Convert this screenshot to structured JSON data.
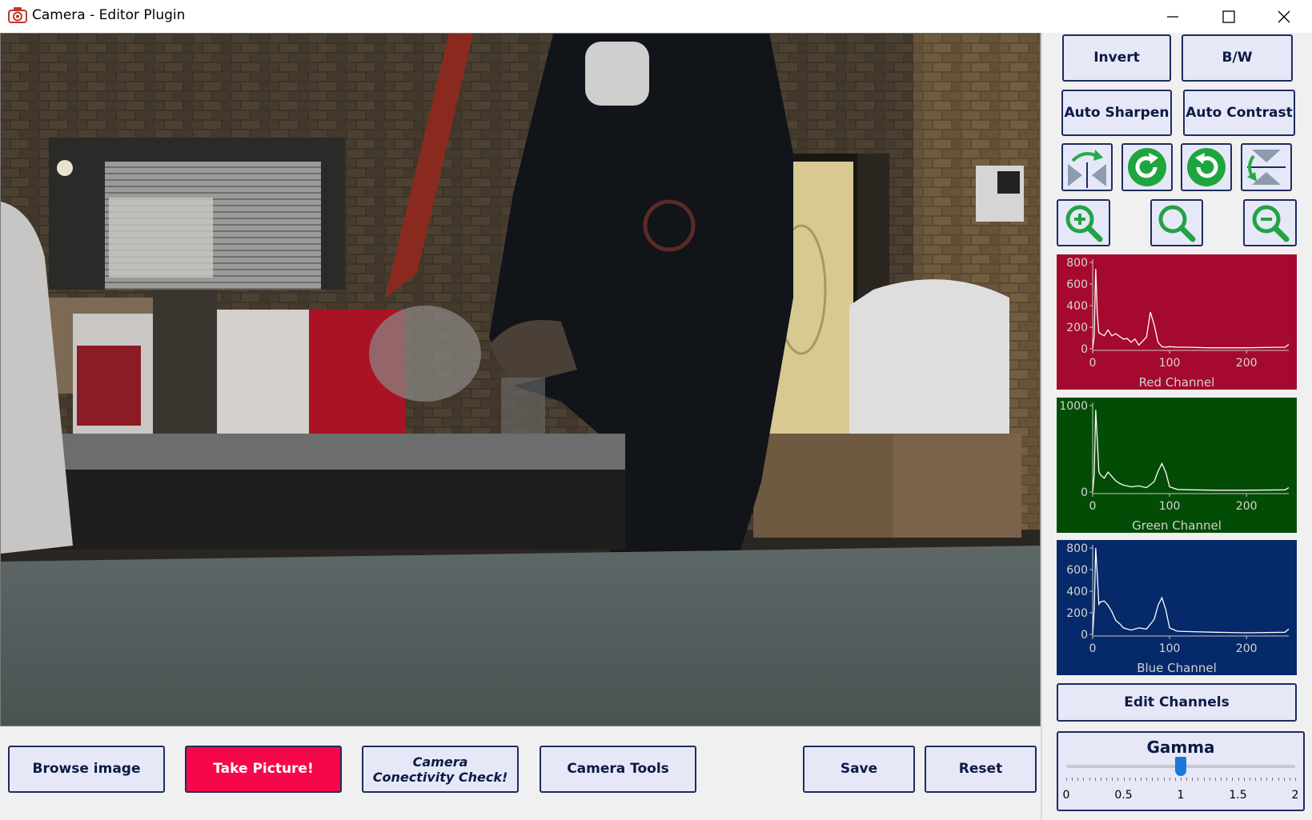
{
  "window": {
    "title": "Camera - Editor Plugin"
  },
  "right_panel": {
    "invert_label": "Invert",
    "bw_label": "B/W",
    "auto_sharpen_label": "Auto Sharpen",
    "auto_contrast_label": "Auto Contrast",
    "tool_icons": [
      "flip-horizontal-icon",
      "rotate-clockwise-icon",
      "rotate-counterclockwise-icon",
      "flip-vertical-icon"
    ],
    "zoom_icons": [
      "zoom-in-icon",
      "zoom-reset-icon",
      "zoom-out-icon"
    ],
    "edit_channels_label": "Edit Channels"
  },
  "bottom_bar": {
    "browse_label": "Browse image",
    "take_picture_label": "Take Picture!",
    "conn_check_line1": "Camera",
    "conn_check_line2": "Conectivity Check!",
    "camera_tools_label": "Camera Tools",
    "save_label": "Save",
    "reset_label": "Reset"
  },
  "gamma": {
    "title": "Gamma",
    "min": 0,
    "max": 2,
    "value": 1,
    "ticks": [
      "0",
      "0.5",
      "1",
      "1.5",
      "2"
    ]
  },
  "colors": {
    "red_panel": "#a50a2e",
    "green_panel": "#034c05",
    "blue_panel": "#06296a",
    "take_picture": "#f5074a",
    "button_bg": "#e6e8f8"
  },
  "chart_data": [
    {
      "type": "line",
      "title": "Red Channel",
      "xlim": [
        0,
        255
      ],
      "ylim": [
        0,
        800
      ],
      "xticks": [
        "0",
        "100",
        "200"
      ],
      "yticks": [
        "0",
        "200",
        "400",
        "600",
        "800"
      ],
      "series": [
        {
          "x": [
            0,
            2,
            4,
            6,
            8,
            10,
            15,
            20,
            25,
            30,
            35,
            40,
            45,
            50,
            55,
            60,
            65,
            70,
            75,
            80,
            85,
            90,
            95,
            100,
            110,
            120,
            150,
            200,
            250,
            255
          ],
          "values": [
            5,
            120,
            740,
            320,
            150,
            140,
            120,
            175,
            120,
            140,
            115,
            90,
            95,
            60,
            90,
            35,
            70,
            110,
            340,
            220,
            60,
            20,
            15,
            20,
            15,
            15,
            10,
            10,
            15,
            40
          ]
        }
      ]
    },
    {
      "type": "line",
      "title": "Green Channel",
      "xlim": [
        0,
        255
      ],
      "ylim": [
        0,
        1000
      ],
      "xticks": [
        "0",
        "100",
        "200"
      ],
      "yticks": [
        "0",
        "1000"
      ],
      "series": [
        {
          "x": [
            0,
            2,
            4,
            6,
            8,
            10,
            15,
            20,
            25,
            30,
            35,
            40,
            50,
            60,
            70,
            80,
            85,
            90,
            95,
            100,
            110,
            130,
            160,
            200,
            250,
            255
          ],
          "values": [
            5,
            200,
            950,
            600,
            240,
            200,
            160,
            230,
            180,
            130,
            100,
            80,
            60,
            70,
            50,
            120,
            240,
            330,
            230,
            60,
            30,
            25,
            20,
            20,
            25,
            50
          ]
        }
      ]
    },
    {
      "type": "line",
      "title": "Blue Channel",
      "xlim": [
        0,
        255
      ],
      "ylim": [
        0,
        800
      ],
      "xticks": [
        "0",
        "100",
        "200"
      ],
      "yticks": [
        "0",
        "200",
        "400",
        "600",
        "800"
      ],
      "series": [
        {
          "x": [
            0,
            2,
            4,
            6,
            8,
            10,
            15,
            20,
            25,
            30,
            35,
            40,
            50,
            60,
            70,
            80,
            85,
            90,
            95,
            100,
            110,
            130,
            160,
            200,
            250,
            255
          ],
          "values": [
            5,
            230,
            800,
            550,
            280,
            300,
            310,
            270,
            210,
            130,
            100,
            60,
            40,
            60,
            50,
            140,
            270,
            340,
            230,
            60,
            30,
            25,
            20,
            15,
            20,
            50
          ]
        }
      ]
    }
  ]
}
